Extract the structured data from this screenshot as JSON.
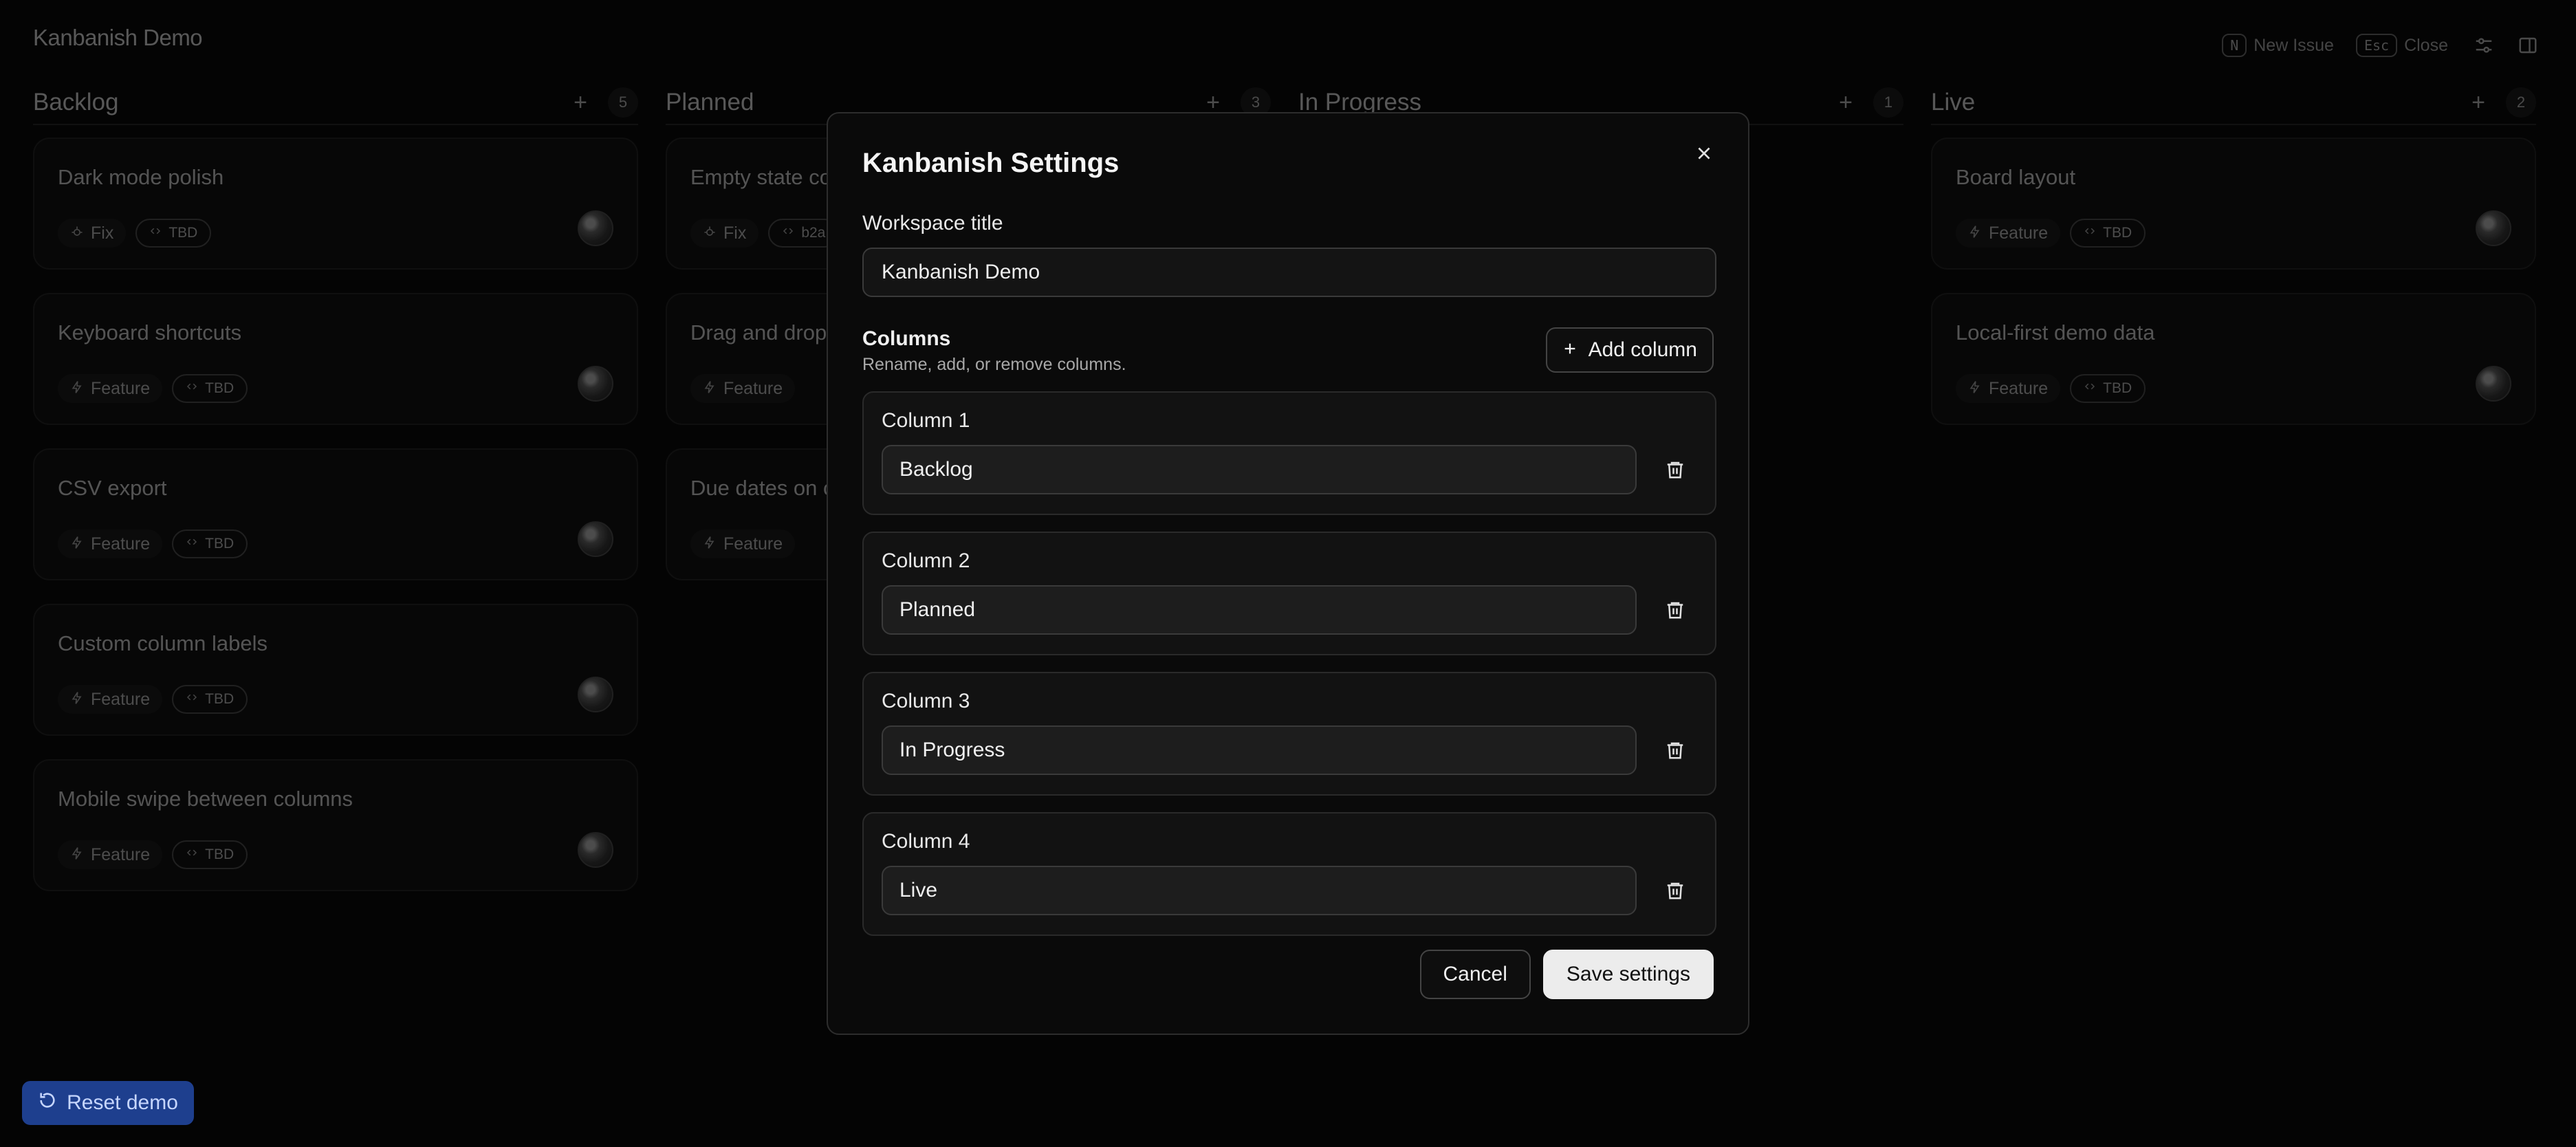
{
  "app": {
    "title": "Kanbanish Demo"
  },
  "topbar": {
    "new_issue_key": "N",
    "new_issue_label": "New Issue",
    "close_key": "Esc",
    "close_label": "Close",
    "icons": [
      "sliders-icon",
      "sidebar-icon"
    ]
  },
  "board": {
    "columns": [
      {
        "title": "Backlog",
        "count": "5",
        "cards": [
          {
            "title": "Dark mode polish",
            "tag": "Fix",
            "tag_icon": "bug-icon",
            "ref": "TBD"
          },
          {
            "title": "Keyboard shortcuts",
            "tag": "Feature",
            "tag_icon": "sparkle-icon",
            "ref": "TBD"
          },
          {
            "title": "CSV export",
            "tag": "Feature",
            "tag_icon": "sparkle-icon",
            "ref": "TBD"
          },
          {
            "title": "Custom column labels",
            "tag": "Feature",
            "tag_icon": "sparkle-icon",
            "ref": "TBD"
          },
          {
            "title": "Mobile swipe between columns",
            "tag": "Feature",
            "tag_icon": "sparkle-icon",
            "ref": "TBD"
          }
        ]
      },
      {
        "title": "Planned",
        "count": "3",
        "cards": [
          {
            "title": "Empty state co",
            "tag": "Fix",
            "tag_icon": "bug-icon",
            "ref": "b2a"
          },
          {
            "title": "Drag and drop",
            "tag": "Feature",
            "tag_icon": "sparkle-icon",
            "ref": ""
          },
          {
            "title": "Due dates on c",
            "tag": "Feature",
            "tag_icon": "sparkle-icon",
            "ref": ""
          }
        ]
      },
      {
        "title": "In Progress",
        "count": "1",
        "cards": []
      },
      {
        "title": "Live",
        "count": "2",
        "cards": [
          {
            "title": "Board layout",
            "tag": "Feature",
            "tag_icon": "sparkle-icon",
            "ref": "TBD"
          },
          {
            "title": "Local-first demo data",
            "tag": "Feature",
            "tag_icon": "sparkle-icon",
            "ref": "TBD"
          }
        ]
      }
    ]
  },
  "settings": {
    "title": "Kanbanish Settings",
    "workspace_label": "Workspace title",
    "workspace_value": "Kanbanish Demo",
    "columns_title": "Columns",
    "columns_subtitle": "Rename, add, or remove columns.",
    "add_column_label": "Add column",
    "columns": [
      {
        "label": "Column 1",
        "value": "Backlog"
      },
      {
        "label": "Column 2",
        "value": "Planned"
      },
      {
        "label": "Column 3",
        "value": "In Progress"
      },
      {
        "label": "Column 4",
        "value": "Live"
      }
    ],
    "cancel_label": "Cancel",
    "save_label": "Save settings"
  },
  "reset": {
    "label": "Reset demo"
  },
  "colors": {
    "accent": "#1e3f8e",
    "background": "#050505",
    "modal": "#0a0a0a"
  }
}
